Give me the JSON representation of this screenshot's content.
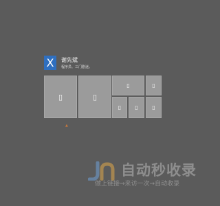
{
  "profile": {
    "avatar_letter": "X",
    "name": "谢先斌",
    "subtitle": "程序员、三门剧迷。",
    "accent_color": "#2f6fbf"
  },
  "tiles": [
    {
      "icon": "file-icon",
      "glyph": "▯"
    },
    {
      "icon": "file-icon",
      "glyph": "▯"
    },
    {
      "icon": "file-icon",
      "glyph": "▯"
    },
    {
      "icon": "file-icon",
      "glyph": "▯"
    },
    {
      "icon": "file-icon",
      "glyph": "▯"
    },
    {
      "icon": "file-icon",
      "glyph": "▯"
    },
    {
      "icon": "file-icon",
      "glyph": "▯"
    }
  ],
  "watermark": {
    "title": "自动秒收录",
    "subtitle": "做上链接→来访一次→自动收录"
  }
}
